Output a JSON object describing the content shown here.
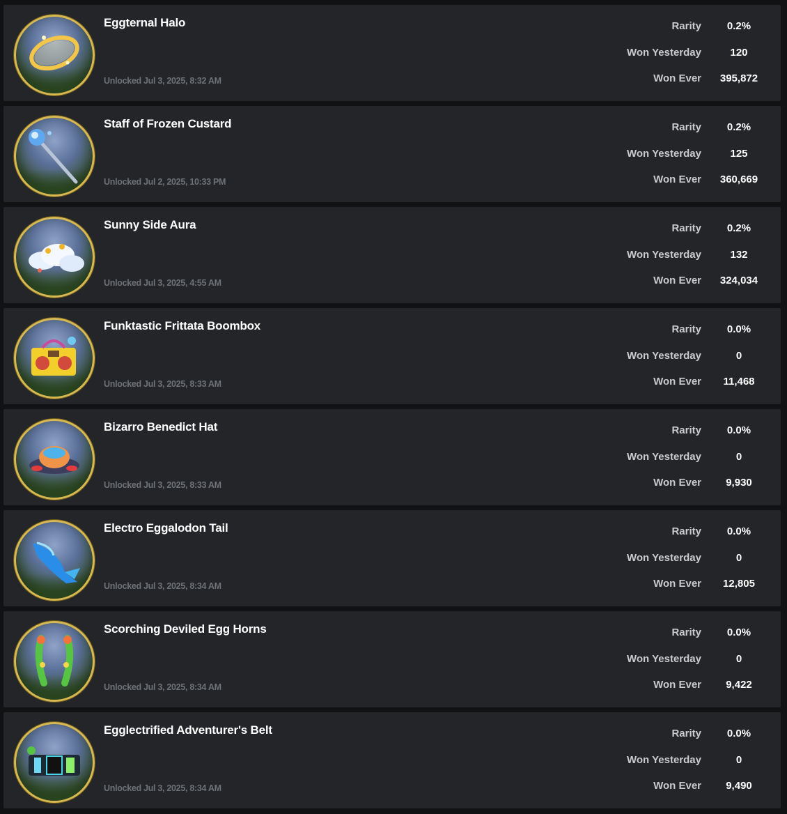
{
  "labels": {
    "rarity": "Rarity",
    "won_yesterday": "Won Yesterday",
    "won_ever": "Won Ever"
  },
  "colors": {
    "page_background": "#111214",
    "card_background": "#232529",
    "badge_ring": "#d8b850",
    "label_text": "#c9cbcf",
    "muted_text": "#6e7176"
  },
  "badges": [
    {
      "name": "Eggternal Halo",
      "unlocked": "Unlocked Jul 3, 2025, 8:32 AM",
      "rarity": "0.2%",
      "won_yesterday": "120",
      "won_ever": "395,872",
      "icon": "golden-halo-icon"
    },
    {
      "name": "Staff of Frozen Custard",
      "unlocked": "Unlocked Jul 2, 2025, 10:33 PM",
      "rarity": "0.2%",
      "won_yesterday": "125",
      "won_ever": "360,669",
      "icon": "ice-staff-icon"
    },
    {
      "name": "Sunny Side Aura",
      "unlocked": "Unlocked Jul 3, 2025, 4:55 AM",
      "rarity": "0.2%",
      "won_yesterday": "132",
      "won_ever": "324,034",
      "icon": "cloud-aura-icon"
    },
    {
      "name": "Funktastic Frittata Boombox",
      "unlocked": "Unlocked Jul 3, 2025, 8:33 AM",
      "rarity": "0.0%",
      "won_yesterday": "0",
      "won_ever": "11,468",
      "icon": "boombox-icon"
    },
    {
      "name": "Bizarro Benedict Hat",
      "unlocked": "Unlocked Jul 3, 2025, 8:33 AM",
      "rarity": "0.0%",
      "won_yesterday": "0",
      "won_ever": "9,930",
      "icon": "hat-icon"
    },
    {
      "name": "Electro Eggalodon Tail",
      "unlocked": "Unlocked Jul 3, 2025, 8:34 AM",
      "rarity": "0.0%",
      "won_yesterday": "0",
      "won_ever": "12,805",
      "icon": "shark-tail-icon"
    },
    {
      "name": "Scorching Deviled Egg Horns",
      "unlocked": "Unlocked Jul 3, 2025, 8:34 AM",
      "rarity": "0.0%",
      "won_yesterday": "0",
      "won_ever": "9,422",
      "icon": "horns-icon"
    },
    {
      "name": "Egglectrified Adventurer's Belt",
      "unlocked": "Unlocked Jul 3, 2025, 8:34 AM",
      "rarity": "0.0%",
      "won_yesterday": "0",
      "won_ever": "9,490",
      "icon": "belt-icon"
    }
  ]
}
